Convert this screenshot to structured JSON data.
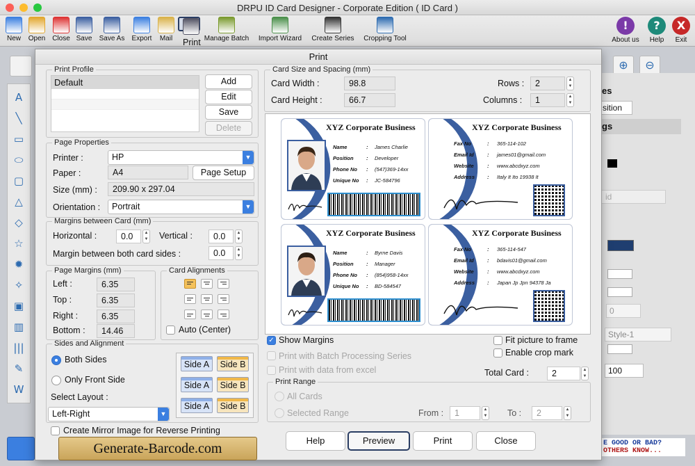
{
  "app": {
    "title": "DRPU ID Card Designer - Corporate Edition ( ID Card )"
  },
  "toolbar": [
    {
      "label": "New",
      "icon": "new-icon"
    },
    {
      "label": "Open",
      "icon": "open-folder-icon"
    },
    {
      "label": "Close",
      "icon": "close-doc-icon"
    },
    {
      "label": "Save",
      "icon": "save-icon"
    },
    {
      "label": "Save As",
      "icon": "save-as-icon"
    },
    {
      "label": "Export",
      "icon": "export-icon"
    },
    {
      "label": "Mail",
      "icon": "mail-icon"
    },
    {
      "label": "Print",
      "icon": "printer-icon"
    },
    {
      "label": "Manage Batch",
      "icon": "batch-icon"
    },
    {
      "label": "Import Wizard",
      "icon": "import-wizard-icon"
    },
    {
      "label": "Create Series",
      "icon": "series-icon"
    },
    {
      "label": "Cropping Tool",
      "icon": "crop-icon"
    }
  ],
  "toolbar_right": [
    {
      "label": "About us",
      "glyph": "!",
      "color": "#7b3aa8"
    },
    {
      "label": "Help",
      "glyph": "?",
      "color": "#1e8a7a"
    },
    {
      "label": "Exit",
      "glyph": "X",
      "color": "#c62828"
    }
  ],
  "bg_panel": {
    "frag1": "es",
    "frag2": "sition",
    "frag3": "gs",
    "frag4": "id",
    "frag5": "0",
    "frag6": "Style-1",
    "frag7": "100",
    "banner1": "E GOOD OR BAD?",
    "banner2": "OTHERS KNOW..."
  },
  "dialog": {
    "title": "Print",
    "print_profile": {
      "legend": "Print Profile",
      "items": [
        "Default",
        "",
        "",
        ""
      ],
      "add": "Add",
      "edit": "Edit",
      "save": "Save",
      "delete": "Delete"
    },
    "page_properties": {
      "legend": "Page Properties",
      "printer_label": "Printer :",
      "printer_value": "HP",
      "paper_label": "Paper :",
      "paper_value": "A4",
      "page_setup": "Page Setup",
      "size_label": "Size (mm) :",
      "size_value": "209.90 x 297.04",
      "orientation_label": "Orientation :",
      "orientation_value": "Portrait"
    },
    "margins_between": {
      "legend": "Margins between Card (mm)",
      "horizontal_label": "Horizontal :",
      "horizontal_value": "0.0",
      "vertical_label": "Vertical :",
      "vertical_value": "0.0",
      "both_label": "Margin between both card sides :",
      "both_value": "0.0"
    },
    "page_margins": {
      "legend": "Page Margins (mm)",
      "left_label": "Left :",
      "left_value": "6.35",
      "top_label": "Top :",
      "top_value": "6.35",
      "right_label": "Right :",
      "right_value": "6.35",
      "bottom_label": "Bottom :",
      "bottom_value": "14.46"
    },
    "card_alignments": {
      "legend": "Card Alignments",
      "auto_label": "Auto (Center)"
    },
    "sides": {
      "legend": "Sides and Alignment",
      "both": "Both Sides",
      "front": "Only Front Side",
      "layout_label": "Select Layout :",
      "layout_value": "Left-Right",
      "side_a": "Side A",
      "side_b": "Side B",
      "mirror": "Create Mirror Image for Reverse Printing"
    },
    "card_size": {
      "legend": "Card Size and Spacing (mm)",
      "width_label": "Card Width :",
      "width_value": "98.8",
      "height_label": "Card Height :",
      "height_value": "66.7",
      "rows_label": "Rows :",
      "rows_value": "2",
      "cols_label": "Columns :",
      "cols_value": "1"
    },
    "cards": [
      {
        "company": "XYZ Corporate Business",
        "fields": [
          {
            "k": "Name",
            "v": "James Charlie"
          },
          {
            "k": "Position",
            "v": "Developer"
          },
          {
            "k": "Phone No",
            "v": "(547)369-14xx"
          },
          {
            "k": "Unique No",
            "v": "JC-584796"
          }
        ]
      },
      {
        "company": "XYZ Corporate Business",
        "fields": [
          {
            "k": "Fax No",
            "v": "365-114-102"
          },
          {
            "k": "Email Id",
            "v": "james01@gmail.com"
          },
          {
            "k": "Website",
            "v": "www.abcdxyz.com"
          },
          {
            "k": "Address",
            "v": "Italy It Ito 19938 It"
          }
        ]
      },
      {
        "company": "XYZ Corporate Business",
        "fields": [
          {
            "k": "Name",
            "v": "Byrne Davis"
          },
          {
            "k": "Position",
            "v": "Manager"
          },
          {
            "k": "Phone No",
            "v": "(854)958-14xx"
          },
          {
            "k": "Unique No",
            "v": "BD-584547"
          }
        ]
      },
      {
        "company": "XYZ Corporate Business",
        "fields": [
          {
            "k": "Fax No",
            "v": "365-114-547"
          },
          {
            "k": "Email Id",
            "v": "bdavis01@gmail.com"
          },
          {
            "k": "Website",
            "v": "www.abcdxyz.com"
          },
          {
            "k": "Address",
            "v": "Japan Jp Jpn 94378 Ja"
          }
        ]
      }
    ],
    "options": {
      "show_margins": "Show Margins",
      "batch": "Print with Batch Processing Series",
      "excel": "Print with data from excel",
      "fit": "Fit picture to frame",
      "crop": "Enable crop mark",
      "total_label": "Total Card :",
      "total_value": "2"
    },
    "range": {
      "legend": "Print Range",
      "all": "All Cards",
      "selected": "Selected Range",
      "from_label": "From :",
      "from_value": "1",
      "to_label": "To :",
      "to_value": "2"
    },
    "buttons": {
      "help": "Help",
      "preview": "Preview",
      "print": "Print",
      "close": "Close"
    }
  },
  "watermark": "Generate-Barcode.com"
}
